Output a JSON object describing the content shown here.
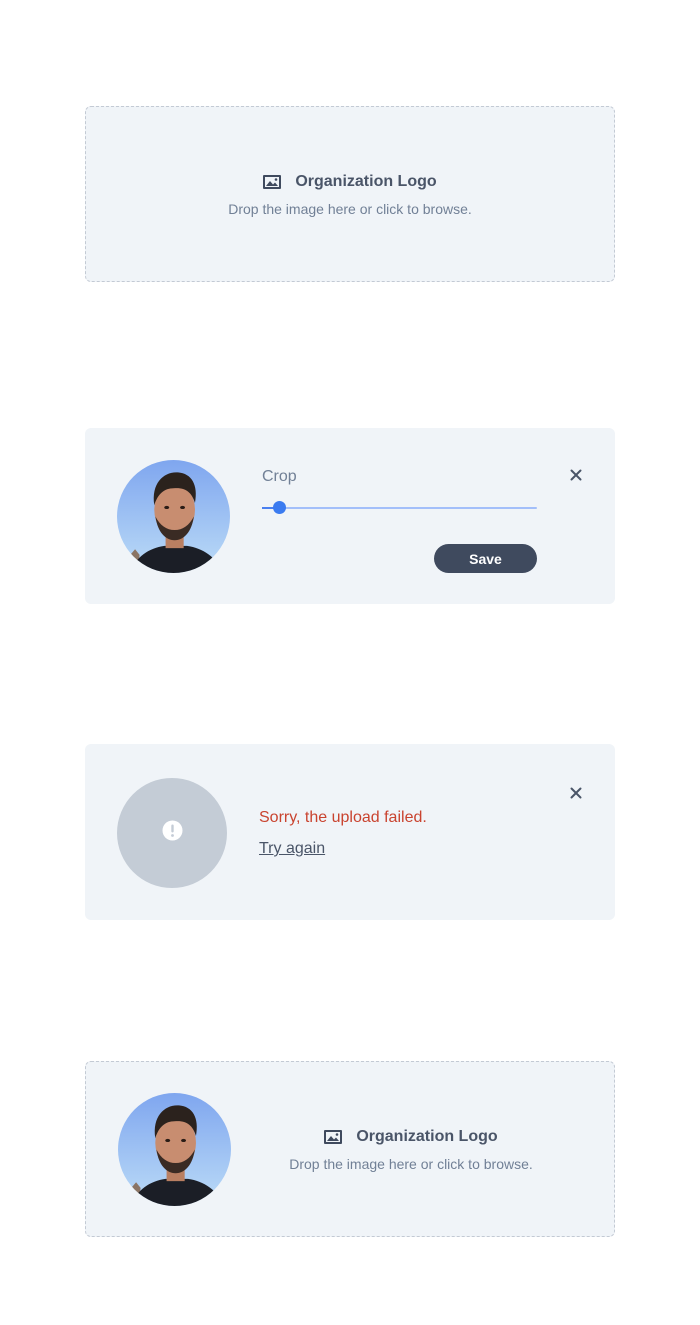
{
  "dropzone": {
    "title": "Organization Logo",
    "subtitle": "Drop the image here or click to browse."
  },
  "crop_panel": {
    "crop_label": "Crop",
    "save_label": "Save",
    "slider_value": 0.06
  },
  "error_panel": {
    "message": "Sorry, the upload failed.",
    "retry_label": "Try again"
  },
  "dropzone_with_preview": {
    "title": "Organization Logo",
    "subtitle": "Drop the image here or click to browse."
  },
  "icons": {
    "image": "image-icon",
    "close": "close-icon",
    "alert": "exclamation-icon"
  },
  "colors": {
    "panel_bg": "#f0f4f8",
    "accent": "#3b7bf0",
    "error": "#c9432f",
    "button": "#3f4a5e"
  }
}
